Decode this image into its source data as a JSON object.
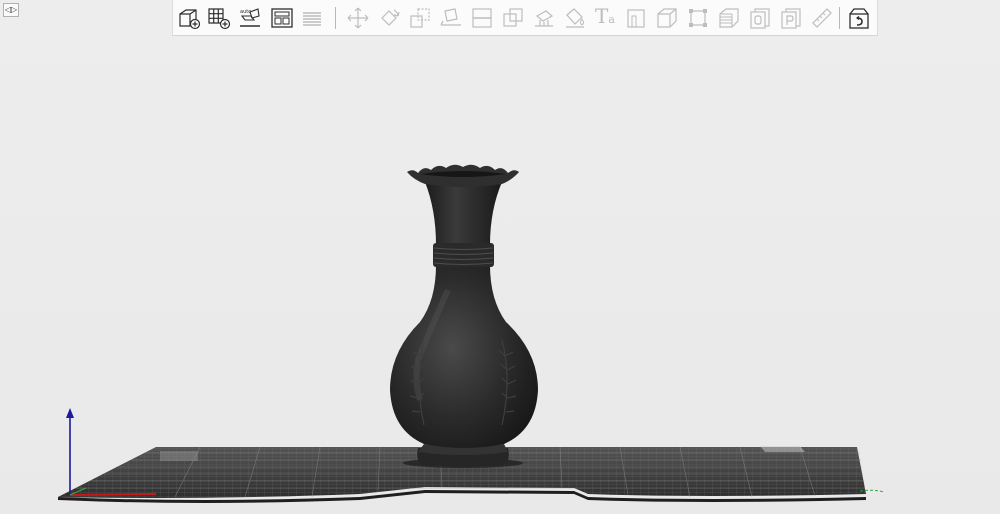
{
  "panel_toggle": {
    "label": "◁▷"
  },
  "toolbar": {
    "buttons": [
      {
        "name": "add-model-button",
        "icon": "cube-plus-icon",
        "enabled": true
      },
      {
        "name": "add-array-button",
        "icon": "grid-plus-icon",
        "enabled": true
      },
      {
        "name": "auto-arrange-button",
        "icon": "auto-place-icon",
        "enabled": true
      },
      {
        "name": "layout-button",
        "icon": "layout-icon",
        "enabled": true
      },
      {
        "name": "layers-button",
        "icon": "layers-icon",
        "enabled": false
      },
      {
        "name": "move-button",
        "icon": "move-arrows-icon",
        "enabled": false
      },
      {
        "name": "rotate-button",
        "icon": "rotate-icon",
        "enabled": false
      },
      {
        "name": "scale-button",
        "icon": "scale-icon",
        "enabled": false
      },
      {
        "name": "lay-flat-button",
        "icon": "lay-flat-icon",
        "enabled": false
      },
      {
        "name": "cut-button",
        "icon": "cut-icon",
        "enabled": false
      },
      {
        "name": "split-button",
        "icon": "split-icon",
        "enabled": false
      },
      {
        "name": "support-button",
        "icon": "support-icon",
        "enabled": false
      },
      {
        "name": "paint-button",
        "icon": "paint-bucket-icon",
        "enabled": false
      },
      {
        "name": "text-button",
        "icon": "text-icon",
        "enabled": false
      },
      {
        "name": "measure-button",
        "icon": "measure-icon",
        "enabled": false
      },
      {
        "name": "hollow-button",
        "icon": "hollow-cube-icon",
        "enabled": false
      },
      {
        "name": "bounding-box-button",
        "icon": "bounding-box-icon",
        "enabled": false
      },
      {
        "name": "slice-layers-button",
        "icon": "stacked-layers-icon",
        "enabled": false
      },
      {
        "name": "object-list-button",
        "icon": "object-list-icon",
        "enabled": false
      },
      {
        "name": "plate-button",
        "icon": "plate-icon",
        "enabled": false
      },
      {
        "name": "ruler-button",
        "icon": "ruler-icon",
        "enabled": false
      },
      {
        "name": "preview-button",
        "icon": "preview-box-icon",
        "enabled": true
      }
    ],
    "text_tool_glyph": "T",
    "text_tool_sub": "a"
  },
  "colors": {
    "toolbar_bg": "#fbfbfb",
    "icon_active": "#2e2e2e",
    "icon_disabled": "#bdbdbd",
    "model": "#2b2b2b",
    "bed": "#3c3c3c",
    "axis_x": "#c21a1a",
    "axis_y": "#2ea84a",
    "axis_z": "#1b1b9e"
  },
  "scene": {
    "model_name": "vase-model",
    "axes": [
      "x-axis",
      "y-axis",
      "z-axis"
    ]
  }
}
